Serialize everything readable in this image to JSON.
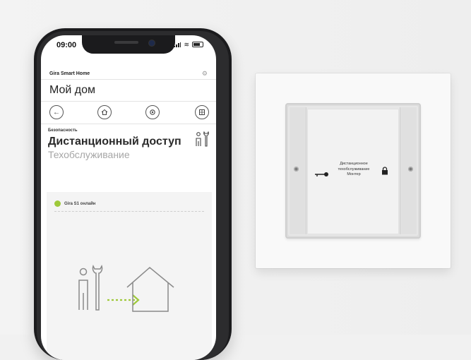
{
  "phone": {
    "status_time": "09:00",
    "app_name": "Gira Smart Home",
    "page_title": "Мой дом",
    "nav_icons": [
      "back-arrow-icon",
      "home-icon",
      "scene-icon",
      "grid-icon"
    ],
    "section_label": "Безопасность",
    "main_title": "Дистанционный доступ",
    "sub_title": "Техобслуживание",
    "card": {
      "status_label": "Gira S1 онлайн",
      "status_color": "#9ec93a"
    }
  },
  "switch": {
    "line1": "Дистанционное",
    "line2": "техобслуживание",
    "line3": "Монтер"
  }
}
